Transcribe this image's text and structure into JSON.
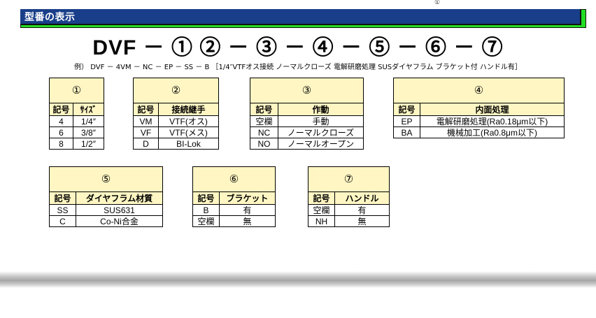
{
  "page": {
    "top_mark": "①",
    "header_title": "型番の表示",
    "model_formula": "DVF － ① ② － ③ － ④ － ⑤ － ⑥ － ⑦",
    "example": "例） DVF － 4VM － NC － EP － SS － B ［1/4″VTFオス接続 ノーマルクローズ 電解研磨処理 SUSダイヤフラム ブラケット付 ハンドル有］"
  },
  "tables": {
    "t1": {
      "title": "①",
      "headers": [
        "記号",
        "ｻｲｽﾞ"
      ],
      "rows": [
        [
          "4",
          "1/4″"
        ],
        [
          "6",
          "3/8″"
        ],
        [
          "8",
          "1/2″"
        ]
      ]
    },
    "t2": {
      "title": "②",
      "headers": [
        "記号",
        "接続継手"
      ],
      "rows": [
        [
          "VM",
          "VTF(オス)"
        ],
        [
          "VF",
          "VTF(メス)"
        ],
        [
          "D",
          "BI-Lok"
        ]
      ]
    },
    "t3": {
      "title": "③",
      "headers": [
        "記号",
        "作動"
      ],
      "rows": [
        [
          "空欄",
          "手動"
        ],
        [
          "NC",
          "ノーマルクローズ"
        ],
        [
          "NO",
          "ノーマルオープン"
        ]
      ]
    },
    "t4": {
      "title": "④",
      "headers": [
        "記号",
        "内面処理"
      ],
      "rows": [
        [
          "EP",
          "電解研磨処理(Ra0.18μm以下)"
        ],
        [
          "BA",
          "機械加工(Ra0.8μm以下)"
        ]
      ]
    },
    "t5": {
      "title": "⑤",
      "headers": [
        "記号",
        "ダイヤフラム材質"
      ],
      "rows": [
        [
          "SS",
          "SUS631"
        ],
        [
          "C",
          "Co-Ni合金"
        ]
      ]
    },
    "t6": {
      "title": "⑥",
      "headers": [
        "記号",
        "ブラケット"
      ],
      "rows": [
        [
          "B",
          "有"
        ],
        [
          "空欄",
          "無"
        ]
      ]
    },
    "t7": {
      "title": "⑦",
      "headers": [
        "記号",
        "ハンドル"
      ],
      "rows": [
        [
          "空欄",
          "有"
        ],
        [
          "NH",
          "無"
        ]
      ]
    }
  },
  "colors": {
    "header_green": "#22dd22",
    "header_navy": "#1a3f8a",
    "table_header_fill": "#fff6c4"
  }
}
